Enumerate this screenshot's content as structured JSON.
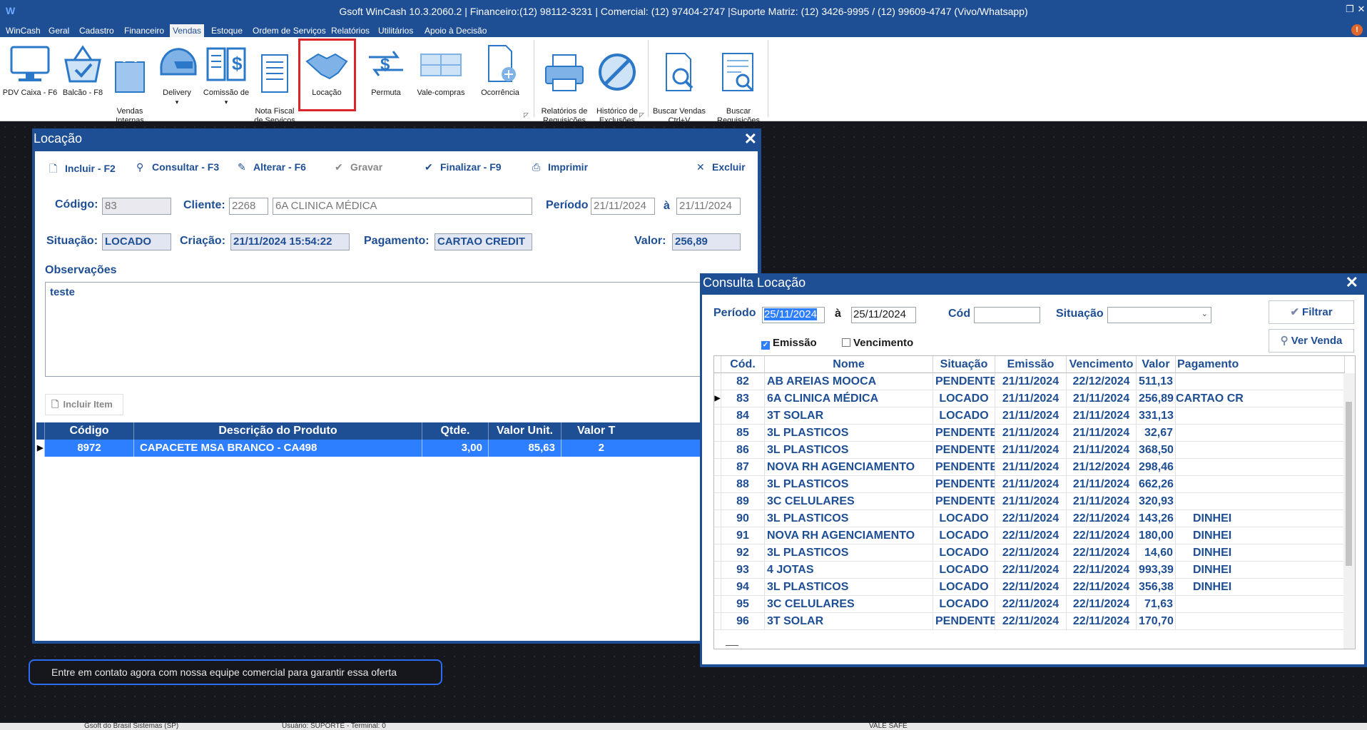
{
  "app": {
    "title": "Gsoft  WinCash 10.3.2060.2 | Financeiro:(12) 98112-3231 | Comercial: (12) 97404-2747 |Suporte Matriz: (12) 3426-9995 / (12) 99609-4747 (Vivo/Whatsapp)"
  },
  "menu": [
    "WinCash",
    "Geral",
    "Cadastro",
    "Financeiro",
    "Vendas",
    "Estoque",
    "Ordem de Serviços",
    "Relatórios",
    "Utilitários",
    "Apoio à Decisão"
  ],
  "menu_active": "Vendas",
  "ribbon": [
    {
      "label": "PDV Caixa - F6",
      "icon": "monitor-icon"
    },
    {
      "label": "Balcão - F8",
      "icon": "basket-icon"
    },
    {
      "label": "Vendas\nInternas",
      "icon": "bag-icon"
    },
    {
      "label": "Delivery",
      "icon": "helmet-icon"
    },
    {
      "label": "Comissão de",
      "icon": "book-dollar-icon"
    },
    {
      "label": "Nota Fiscal\nde Serviços",
      "icon": "invoice-icon"
    },
    {
      "label": "Locação",
      "icon": "handshake-icon"
    },
    {
      "label": "Permuta",
      "icon": "exchange-icon"
    },
    {
      "label": "Vale-compras",
      "icon": "voucher-icon"
    },
    {
      "label": "Ocorrência",
      "icon": "document-add-icon"
    },
    {
      "label": "Relatórios de\nRequisições",
      "icon": "printer-icon"
    },
    {
      "label": "Histórico de\nExclusões",
      "icon": "forbidden-icon"
    },
    {
      "label": "Buscar Vendas\nCtrl+V",
      "icon": "search-document-icon"
    },
    {
      "label": "Buscar\nRequisições",
      "icon": "search-list-icon"
    }
  ],
  "locacao": {
    "title": "Locação",
    "toolbar": {
      "incluir": "Incluir - F2",
      "consultar": "Consultar - F3",
      "alterar": "Alterar - F6",
      "gravar": "Gravar",
      "finalizar": "Finalizar - F9",
      "imprimir": "Imprimir",
      "excluir": "Excluir"
    },
    "labels": {
      "codigo": "Código:",
      "cliente": "Cliente:",
      "periodo": "Período",
      "a": "à",
      "situacao": "Situação:",
      "criacao": "Criação:",
      "pagamento": "Pagamento:",
      "valor": "Valor:",
      "observacoes": "Observações"
    },
    "values": {
      "codigo": "83",
      "cliente_cod": "2268",
      "cliente_nome": "6A CLINICA MÉDICA",
      "periodo_de": "21/11/2024",
      "periodo_ate": "21/11/2024",
      "situacao": "LOCADO",
      "criacao": "21/11/2024 15:54:22",
      "pagamento": "CARTAO CREDIT",
      "valor": "256,89",
      "observacoes": "teste"
    },
    "incluir_item": "Incluir Item",
    "items_columns": [
      "Código",
      "Descrição do Produto",
      "Qtde.",
      "Valor Unit.",
      "Valor T"
    ],
    "items": [
      {
        "codigo": "8972",
        "descricao": "CAPACETE MSA BRANCO - CA498",
        "qtde": "3,00",
        "valor_unit": "85,63",
        "valor_total": "2"
      }
    ]
  },
  "consulta": {
    "title": "Consulta Locação",
    "labels": {
      "periodo": "Período",
      "a": "à",
      "cod": "Cód",
      "situacao": "Situação",
      "emissao": "Emissão",
      "vencimento": "Vencimento"
    },
    "filters": {
      "periodo_de": "25/11/2024",
      "periodo_ate": "25/11/2024",
      "cod": "",
      "situacao": "",
      "emissao_checked": true,
      "vencimento_checked": false
    },
    "buttons": {
      "filtrar": "Filtrar",
      "ver_venda": "Ver Venda"
    },
    "columns": [
      "Cód.",
      "Nome",
      "Situação",
      "Emissão",
      "Vencimento",
      "Valor",
      "Pagamento"
    ],
    "rows": [
      [
        "82",
        "AB AREIAS MOOCA",
        "PENDENTE",
        "21/11/2024",
        "22/12/2024",
        "511,13",
        ""
      ],
      [
        "83",
        "6A CLINICA MÉDICA",
        "LOCADO",
        "21/11/2024",
        "21/11/2024",
        "256,89",
        "CARTAO CR"
      ],
      [
        "84",
        "3T SOLAR",
        "LOCADO",
        "21/11/2024",
        "21/11/2024",
        "331,13",
        ""
      ],
      [
        "85",
        "3L PLASTICOS",
        "PENDENTE",
        "21/11/2024",
        "21/11/2024",
        "32,67",
        ""
      ],
      [
        "86",
        "3L PLASTICOS",
        "PENDENTE",
        "21/11/2024",
        "21/11/2024",
        "368,50",
        ""
      ],
      [
        "87",
        " NOVA RH AGENCIAMENTO",
        "PENDENTE",
        "21/11/2024",
        "21/12/2024",
        "298,46",
        ""
      ],
      [
        "88",
        "3L PLASTICOS",
        "PENDENTE",
        "21/11/2024",
        "21/11/2024",
        "662,26",
        ""
      ],
      [
        "89",
        "3C CELULARES",
        "PENDENTE",
        "21/11/2024",
        "21/11/2024",
        "320,93",
        ""
      ],
      [
        "90",
        "3L PLASTICOS",
        "LOCADO",
        "22/11/2024",
        "22/11/2024",
        "143,26",
        "DINHEI"
      ],
      [
        "91",
        " NOVA RH AGENCIAMENTO",
        "LOCADO",
        "22/11/2024",
        "22/11/2024",
        "180,00",
        "DINHEI"
      ],
      [
        "92",
        "3L PLASTICOS",
        "LOCADO",
        "22/11/2024",
        "22/11/2024",
        "14,60",
        "DINHEI"
      ],
      [
        "93",
        "4 JOTAS",
        "LOCADO",
        "22/11/2024",
        "22/11/2024",
        "993,39",
        "DINHEI"
      ],
      [
        "94",
        "3L PLASTICOS",
        "LOCADO",
        "22/11/2024",
        "22/11/2024",
        "356,38",
        "DINHEI"
      ],
      [
        "95",
        "3C CELULARES",
        "LOCADO",
        "22/11/2024",
        "22/11/2024",
        "71,63",
        ""
      ],
      [
        "96",
        "3T SOLAR",
        "PENDENTE",
        "22/11/2024",
        "22/11/2024",
        "170,70",
        ""
      ]
    ],
    "selected_row": "83"
  },
  "promo": "Entre em contato agora com nossa equipe comercial para garantir essa oferta",
  "status": {
    "company": "Gsoft do Brasil Sistemas (SP)",
    "user": "Usuário: SUPORTE - Terminal: 0",
    "module": "VALE SAFE"
  }
}
